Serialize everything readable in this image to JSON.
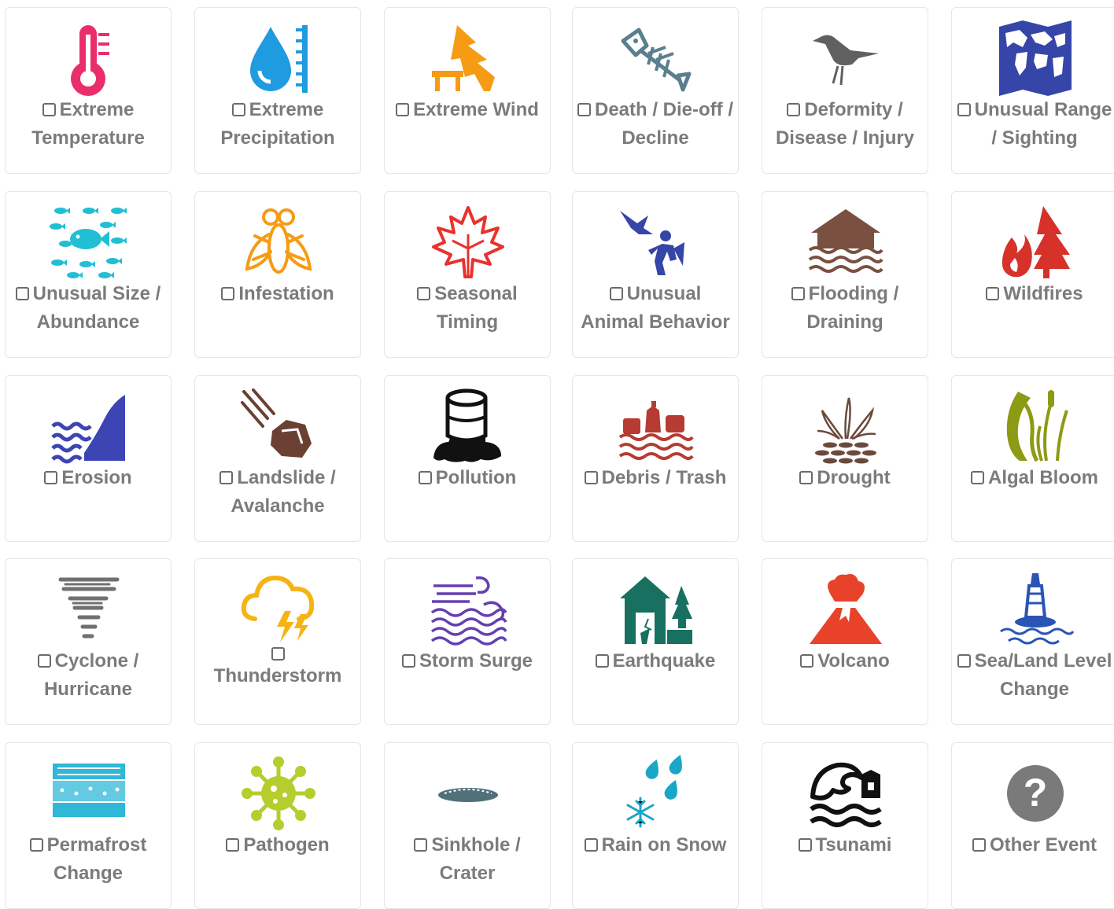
{
  "categories": [
    {
      "id": "extreme-temperature",
      "label": "Extreme Temperature",
      "icon": "thermometer-icon",
      "color": "#ea2e6a"
    },
    {
      "id": "extreme-precipitation",
      "label": "Extreme Precipitation",
      "icon": "raindrop-gauge-icon",
      "color": "#1f9be0"
    },
    {
      "id": "extreme-wind",
      "label": "Extreme Wind",
      "icon": "wind-tree-icon",
      "color": "#f59b14"
    },
    {
      "id": "death-die-off-decline",
      "label": "Death / Die-off / Decline",
      "icon": "fish-skeleton-icon",
      "color": "#5a7f8e"
    },
    {
      "id": "deformity-disease-injury",
      "label": "Deformity / Disease / Injury",
      "icon": "bird-icon",
      "color": "#606060"
    },
    {
      "id": "unusual-range-sighting",
      "label": "Unusual Range / Sighting",
      "icon": "world-map-icon",
      "color": "#3545a8"
    },
    {
      "id": "unusual-size-abundance",
      "label": "Unusual Size / Abundance",
      "icon": "fish-school-icon",
      "color": "#21bfd3"
    },
    {
      "id": "infestation",
      "label": "Infestation",
      "icon": "insect-icon",
      "color": "#f59b14"
    },
    {
      "id": "seasonal-timing",
      "label": "Seasonal Timing",
      "icon": "maple-leaf-icon",
      "color": "#e8322d"
    },
    {
      "id": "unusual-animal-behavior",
      "label": "Unusual Animal Behavior",
      "icon": "bird-attack-icon",
      "color": "#3545a8"
    },
    {
      "id": "flooding-draining",
      "label": "Flooding / Draining",
      "icon": "flooded-house-icon",
      "color": "#7a5040"
    },
    {
      "id": "wildfires",
      "label": "Wildfires",
      "icon": "fire-tree-icon",
      "color": "#d6322a"
    },
    {
      "id": "erosion",
      "label": "Erosion",
      "icon": "erosion-waves-icon",
      "color": "#3d45b5"
    },
    {
      "id": "landslide-avalanche",
      "label": "Landslide / Avalanche",
      "icon": "falling-rock-icon",
      "color": "#6a4032"
    },
    {
      "id": "pollution",
      "label": "Pollution",
      "icon": "oil-barrel-icon",
      "color": "#111111"
    },
    {
      "id": "debris-trash",
      "label": "Debris / Trash",
      "icon": "floating-debris-icon",
      "color": "#b53b33"
    },
    {
      "id": "drought",
      "label": "Drought",
      "icon": "dry-plant-icon",
      "color": "#6a4a3c"
    },
    {
      "id": "algal-bloom",
      "label": "Algal Bloom",
      "icon": "algae-icon",
      "color": "#8c9a14"
    },
    {
      "id": "cyclone-hurricane",
      "label": "Cyclone / Hurricane",
      "icon": "tornado-icon",
      "color": "#707070"
    },
    {
      "id": "thunderstorm",
      "label": "Thunderstorm",
      "icon": "storm-cloud-icon",
      "color": "#f5b414",
      "checkbox_above": true
    },
    {
      "id": "storm-surge",
      "label": "Storm Surge",
      "icon": "storm-waves-icon",
      "color": "#6540b0"
    },
    {
      "id": "earthquake",
      "label": "Earthquake",
      "icon": "cracked-house-icon",
      "color": "#177060"
    },
    {
      "id": "volcano",
      "label": "Volcano",
      "icon": "volcano-icon",
      "color": "#e8432a"
    },
    {
      "id": "sea-land-level-change",
      "label": "Sea/Land Level Change",
      "icon": "buoy-icon",
      "color": "#2a55b5"
    },
    {
      "id": "permafrost-change",
      "label": "Permafrost Change",
      "icon": "permafrost-layers-icon",
      "color": "#2fb8d8"
    },
    {
      "id": "pathogen",
      "label": "Pathogen",
      "icon": "virus-icon",
      "color": "#b6cd2e"
    },
    {
      "id": "sinkhole-crater",
      "label": "Sinkhole / Crater",
      "icon": "sinkhole-icon",
      "color": "#51707a"
    },
    {
      "id": "rain-on-snow",
      "label": "Rain on Snow",
      "icon": "rain-snowflake-icon",
      "color": "#1aa6c6"
    },
    {
      "id": "tsunami",
      "label": "Tsunami",
      "icon": "tsunami-wave-icon",
      "color": "#111111"
    },
    {
      "id": "other-event",
      "label": "Other Event",
      "icon": "question-mark-icon",
      "color": "#7a7a7a"
    }
  ]
}
